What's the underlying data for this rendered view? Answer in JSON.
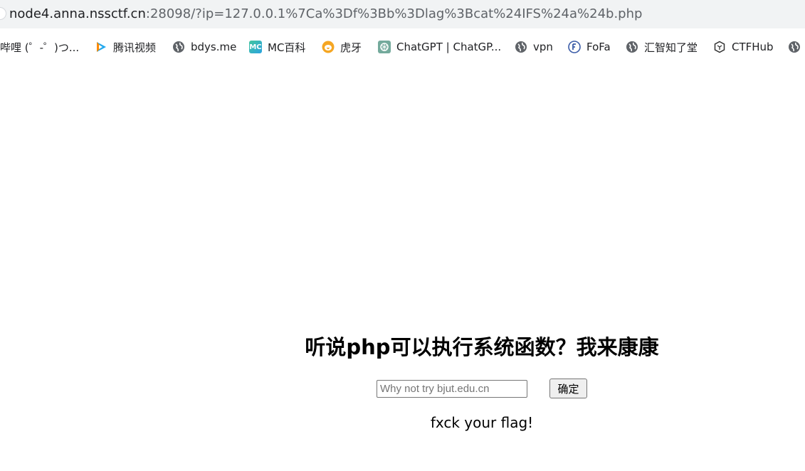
{
  "address_bar": {
    "url_host": "node4.anna.nssctf.cn",
    "url_rest": ":28098/?ip=127.0.0.1%7Ca%3Df%3Bb%3Dlag%3Bcat%24IFS%24a%24b.php"
  },
  "bookmarks": [
    {
      "label": "哔哩 (゜-゜)つ...",
      "icon": "none"
    },
    {
      "label": "腾讯视频",
      "icon": "tencent-video-icon"
    },
    {
      "label": "bdys.me",
      "icon": "globe-icon"
    },
    {
      "label": "MC百科",
      "icon": "mc-icon"
    },
    {
      "label": "虎牙",
      "icon": "huya-icon"
    },
    {
      "label": "ChatGPT | ChatGP...",
      "icon": "chatgpt-icon"
    },
    {
      "label": "vpn",
      "icon": "globe-icon"
    },
    {
      "label": "FoFa",
      "icon": "fofa-icon"
    },
    {
      "label": "汇智知了堂",
      "icon": "globe-icon"
    },
    {
      "label": "CTFHub",
      "icon": "ctfhub-icon"
    },
    {
      "label": "",
      "icon": "globe-icon"
    }
  ],
  "icon_text": {
    "mc": "MC"
  },
  "main": {
    "title": "听说php可以执行系统函数？我来康康",
    "input_placeholder": "Why not try bjut.edu.cn",
    "input_value": "",
    "submit_label": "确定",
    "result": "fxck your flag!"
  },
  "colors": {
    "address_bar_bg": "#f1f3f4",
    "text": "#000000"
  }
}
